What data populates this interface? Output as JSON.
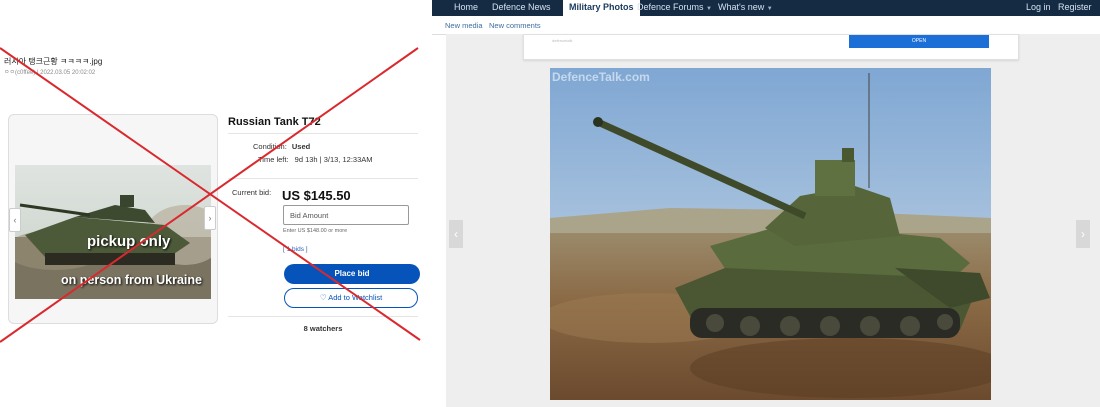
{
  "left": {
    "post_title": "러시아 탱크근황 ㅋㅋㅋㅋ.jpg",
    "post_meta": "ㅇㅇ(c0ffee) | 2022.03.05 20:02:02",
    "listing": {
      "item_title": "Russian Tank T72",
      "condition_label": "Condition:",
      "condition_value": "Used",
      "time_left_label": "Time left:",
      "time_left_value": "9d 13h | 3/13, 12:33AM",
      "current_bid_label": "Current bid:",
      "current_bid_value": "US $145.50",
      "bid_placeholder": "Bid Amount",
      "enter_note": "Enter US $148.00 or more",
      "bids_link": "[ 1 bids ]",
      "place_bid": "Place bid",
      "watchlist": "♡ Add to Watchlist",
      "watchers": "8 watchers",
      "caption_line1": "pickup only",
      "caption_line2": "on person from Ukraine"
    }
  },
  "right": {
    "nav": {
      "items": [
        "Home",
        "Defence News",
        "Military Photos",
        "Defence Forums",
        "What's new"
      ],
      "login": "Log in",
      "register": "Register"
    },
    "subnav": [
      "New media",
      "New comments"
    ],
    "ad_small": "defencetalk",
    "ad_button": "OPEN",
    "watermark": "DefenceTalk.com"
  },
  "colors": {
    "nav_bg": "#152b43",
    "accent": "#0654ba",
    "cross": "#d9292e"
  }
}
